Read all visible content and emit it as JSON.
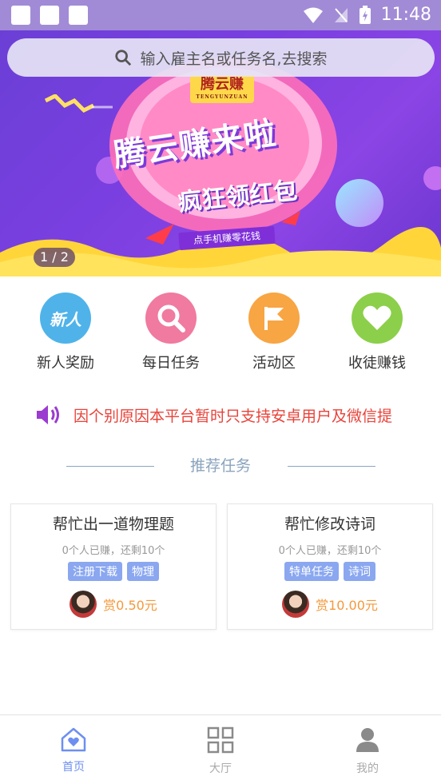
{
  "status_bar": {
    "time": "11:48"
  },
  "search": {
    "placeholder": "输入雇主名或任务名,去搜索"
  },
  "banner": {
    "logo": "腾云赚",
    "logo_sub": "TENGYUNZUAN",
    "headline": "腾云赚来啦",
    "subline": "疯狂领红包",
    "tag": "点手机赚零花钱",
    "pager": "1 / 2"
  },
  "actions": [
    {
      "label": "新人奖励",
      "icon": "new-user-icon",
      "color": "#4fb3ea",
      "icon_text": "新人"
    },
    {
      "label": "每日任务",
      "icon": "search-icon",
      "color": "#f07aa0"
    },
    {
      "label": "活动区",
      "icon": "flag-icon",
      "color": "#f8a543"
    },
    {
      "label": "收徒赚钱",
      "icon": "heart-icon",
      "color": "#8ccf4a"
    }
  ],
  "notice": {
    "text": "因个别原因本平台暂时只支持安卓用户及微信提"
  },
  "section": {
    "title": "推荐任务"
  },
  "tasks": [
    {
      "title": "帮忙出一道物理题",
      "stats": "0个人已赚，还剩10个",
      "tags": [
        "注册下载",
        "物理"
      ],
      "reward": "赏0.50元"
    },
    {
      "title": "帮忙修改诗词",
      "stats": "0个人已赚，还剩10个",
      "tags": [
        "特单任务",
        "诗词"
      ],
      "reward": "赏10.00元"
    }
  ],
  "nav": [
    {
      "label": "首页",
      "icon": "home-icon",
      "active": true
    },
    {
      "label": "大厅",
      "icon": "grid-icon",
      "active": false
    },
    {
      "label": "我的",
      "icon": "user-icon",
      "active": false
    }
  ],
  "colors": {
    "accent": "#6d8ff0",
    "status_bar": "#a18bd6",
    "notice": "#e8433a",
    "reward": "#f39a3c",
    "tag": "#8aa7f0"
  }
}
